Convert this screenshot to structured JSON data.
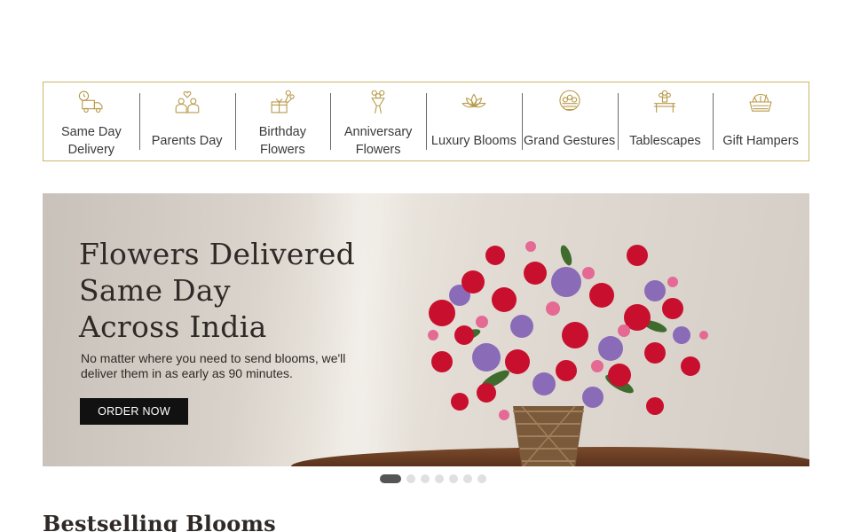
{
  "categories": [
    {
      "label": "Same Day\nDelivery",
      "icon": "delivery-truck-icon"
    },
    {
      "label": "Parents Day",
      "icon": "parents-icon"
    },
    {
      "label": "Birthday\nFlowers",
      "icon": "gift-flowers-icon"
    },
    {
      "label": "Anniversary\nFlowers",
      "icon": "bouquet-icon"
    },
    {
      "label": "Luxury Blooms",
      "icon": "lotus-icon"
    },
    {
      "label": "Grand Gestures",
      "icon": "flower-basket-icon"
    },
    {
      "label": "Tablescapes",
      "icon": "table-flowers-icon"
    },
    {
      "label": "Gift Hampers",
      "icon": "hamper-icon"
    }
  ],
  "banner": {
    "title": "Flowers Delivered\nSame Day\nAcross India",
    "subtitle": "No matter where you need to send blooms, we'll deliver them in as early as 90 minutes.",
    "cta": "ORDER NOW"
  },
  "carousel": {
    "count": 7,
    "active": 0
  },
  "section": {
    "title": "Bestselling Blooms"
  },
  "colors": {
    "accent_border": "#c9b56a",
    "icon_gold": "#b89a4a",
    "button_bg": "#111111"
  }
}
